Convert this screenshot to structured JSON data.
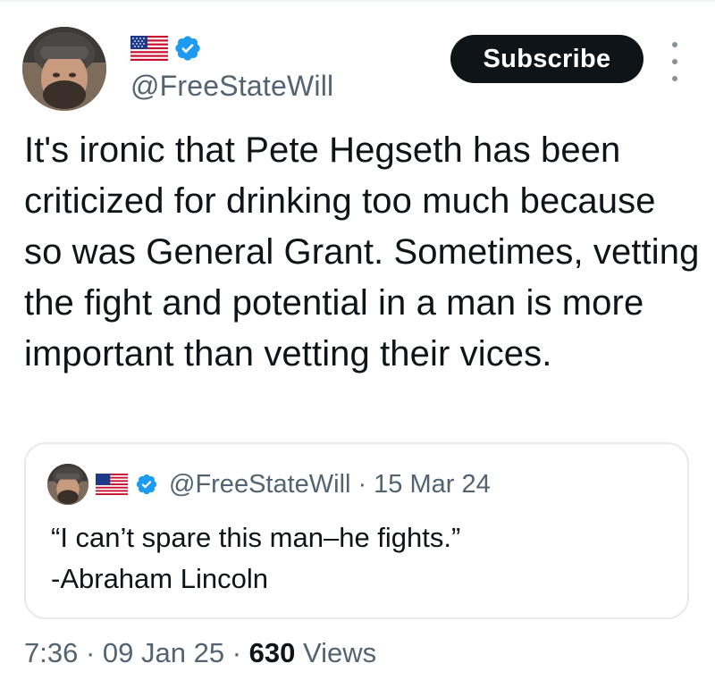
{
  "post": {
    "author": {
      "handle": "@FreeStateWill",
      "flag_emoji": "us-flag",
      "verified": true
    },
    "subscribe_label": "Subscribe",
    "more_icon": "more-vertical-icon",
    "text": "It's ironic that Pete Hegseth has been criticized for drinking too much because so was General Grant. Sometimes, vetting the fight and potential in a man is more important than vetting their vices.",
    "quoted": {
      "handle": "@FreeStateWill",
      "separator": "·",
      "date": "15 Mar 24",
      "text_line1": "“I can’t spare this man–he fights.”",
      "text_line2": "-Abraham Lincoln"
    },
    "meta": {
      "time": "7:36",
      "sep1": " · ",
      "date": "09 Jan 25",
      "sep2": " · ",
      "views_count": "630",
      "views_label": " Views"
    }
  },
  "colors": {
    "text_primary": "#0f1419",
    "text_secondary": "#536471",
    "verified_blue": "#1d9bf0",
    "button_bg": "#0f1419",
    "card_border": "#e6eaed"
  }
}
